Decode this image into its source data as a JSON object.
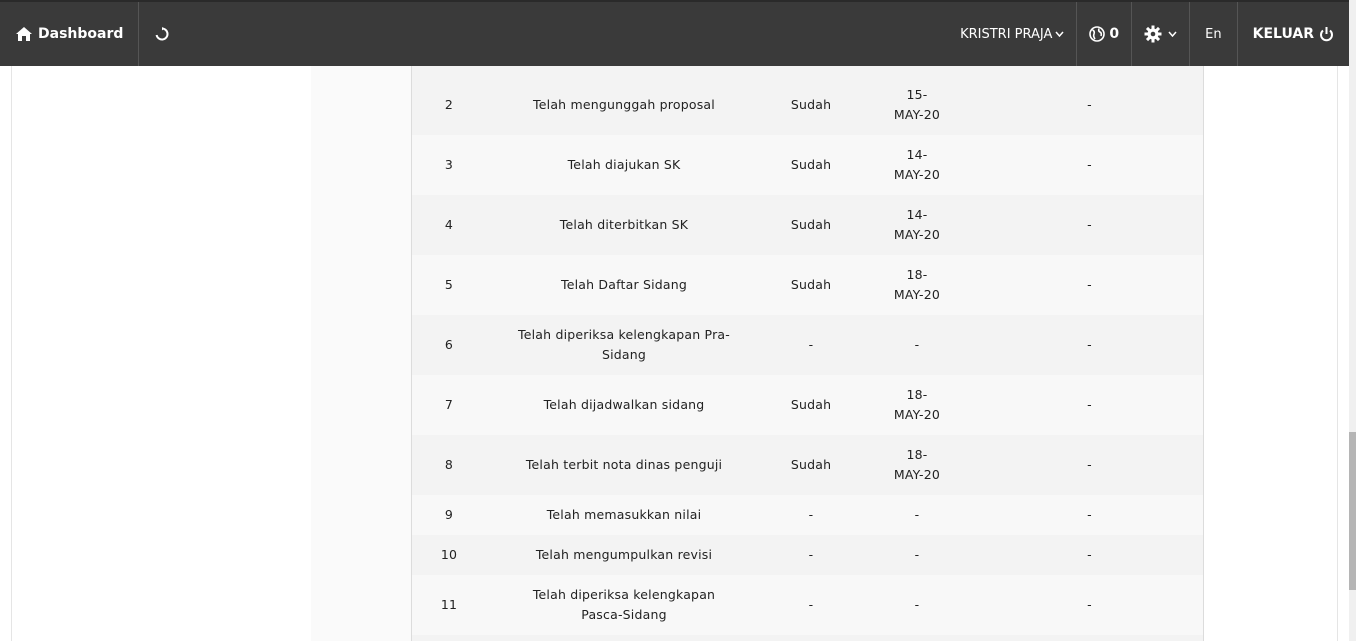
{
  "navbar": {
    "dashboard_label": "Dashboard",
    "user_name": "KRISTRI PRAJA",
    "notification_count": "0",
    "language": "En",
    "logout_label": "KELUAR"
  },
  "table": {
    "rows": [
      {
        "no": "",
        "step": "",
        "status": "",
        "date_line1": "",
        "date_line2": "",
        "note": ""
      },
      {
        "no": "2",
        "step": "Telah mengunggah proposal",
        "status": "Sudah",
        "date_line1": "15-",
        "date_line2": "MAY-20",
        "note": "-"
      },
      {
        "no": "3",
        "step": "Telah diajukan SK",
        "status": "Sudah",
        "date_line1": "14-",
        "date_line2": "MAY-20",
        "note": "-"
      },
      {
        "no": "4",
        "step": "Telah diterbitkan SK",
        "status": "Sudah",
        "date_line1": "14-",
        "date_line2": "MAY-20",
        "note": "-"
      },
      {
        "no": "5",
        "step": "Telah Daftar Sidang",
        "status": "Sudah",
        "date_line1": "18-",
        "date_line2": "MAY-20",
        "note": "-"
      },
      {
        "no": "6",
        "step": "Telah diperiksa kelengkapan Pra-Sidang",
        "status": "-",
        "date_line1": "-",
        "date_line2": "",
        "note": "-"
      },
      {
        "no": "7",
        "step": "Telah dijadwalkan sidang",
        "status": "Sudah",
        "date_line1": "18-",
        "date_line2": "MAY-20",
        "note": "-"
      },
      {
        "no": "8",
        "step": "Telah terbit nota dinas penguji",
        "status": "Sudah",
        "date_line1": "18-",
        "date_line2": "MAY-20",
        "note": "-"
      },
      {
        "no": "9",
        "step": "Telah memasukkan nilai",
        "status": "-",
        "date_line1": "-",
        "date_line2": "",
        "note": "-"
      },
      {
        "no": "10",
        "step": "Telah mengumpulkan revisi",
        "status": "-",
        "date_line1": "-",
        "date_line2": "",
        "note": "-"
      },
      {
        "no": "11",
        "step": "Telah diperiksa kelengkapan Pasca-Sidang",
        "status": "-",
        "date_line1": "-",
        "date_line2": "",
        "note": "-"
      }
    ]
  },
  "colors": {
    "navbar_bg": "#3a3a3a",
    "row_odd": "#f3f3f3",
    "row_even": "#f8f8f8",
    "text": "#222222"
  }
}
